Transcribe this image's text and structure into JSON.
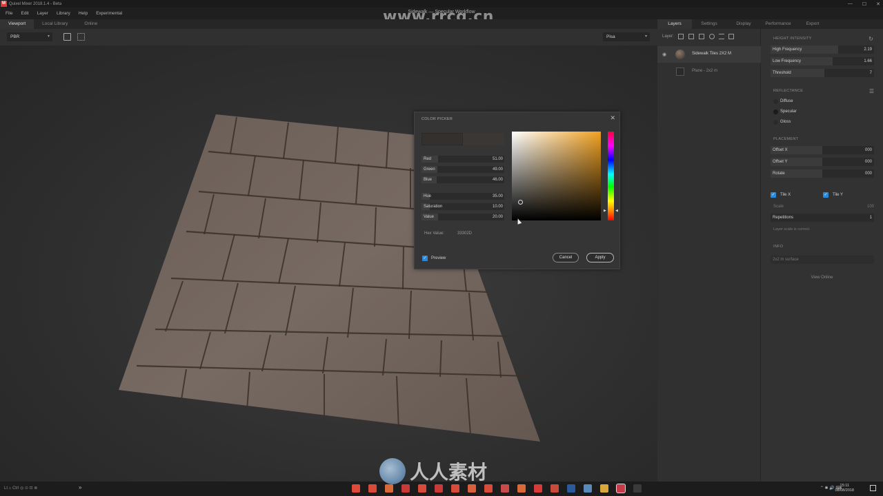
{
  "app": {
    "logo_letter": "M",
    "window_title": "Quixel Mixer 2018.1.4 - Beta",
    "document_title": "Sidewalk — Specular Workflow",
    "watermark_top": "www.rrcg.cn",
    "watermark_bottom": "人人素材"
  },
  "menu": [
    "File",
    "Edit",
    "Layer",
    "Library",
    "Help",
    "Experimental"
  ],
  "left_tabs": [
    "Viewport",
    "Local Library",
    "Online"
  ],
  "viewport": {
    "render_mode": "PBR",
    "environment": "Pisa"
  },
  "color_picker": {
    "title": "COLOR PICKER",
    "fields": [
      {
        "label": "Red",
        "value": "51.00",
        "fill": 0.2
      },
      {
        "label": "Green",
        "value": "49.00",
        "fill": 0.19
      },
      {
        "label": "Blue",
        "value": "46.00",
        "fill": 0.18
      },
      {
        "label": "Hue",
        "value": "35.00",
        "fill": 0.1
      },
      {
        "label": "Saturation",
        "value": "10.00",
        "fill": 0.1
      },
      {
        "label": "Value",
        "value": "20.00",
        "fill": 0.2
      }
    ],
    "hex_label": "Hex Value:",
    "hex_value": "33302D",
    "preview_label": "Preview",
    "cancel_label": "Cancel",
    "apply_label": "Apply",
    "current_color": "#33302e"
  },
  "right_tabs": [
    "Layers",
    "Settings",
    "Display",
    "Performance",
    "Export"
  ],
  "layers": {
    "toolbar_label": "Layer:",
    "items": [
      {
        "name": "Sidewalk Tiles 2X2 M"
      },
      {
        "name": "Plane - 2x2 m"
      }
    ]
  },
  "properties": {
    "height_intensity": {
      "title": "HEIGHT INTENSITY",
      "rows": [
        {
          "label": "High Frequency",
          "value": "2.19",
          "fill": 0.65
        },
        {
          "label": "Low Frequency",
          "value": "1.66",
          "fill": 0.6
        },
        {
          "label": "Threshold",
          "value": "7",
          "fill": 0.52
        }
      ]
    },
    "reflectance": {
      "title": "REFLECTANCE",
      "options": [
        "Diffuse",
        "Specular",
        "Gloss"
      ]
    },
    "placement": {
      "title": "PLACEMENT",
      "rows": [
        {
          "label": "Offset X",
          "value": "000",
          "fill": 0.5
        },
        {
          "label": "Offset Y",
          "value": "000",
          "fill": 0.5
        },
        {
          "label": "Rotate",
          "value": "000",
          "fill": 0.5
        }
      ],
      "tile_x": "Tile X",
      "tile_y": "Tile Y",
      "scale_label": "Scale",
      "scale_value": "100",
      "repetitions_label": "Repetitions",
      "repetitions_value": "1",
      "hint": "Layer scale is correct."
    },
    "info": {
      "title": "INFO",
      "text": "2x2 m surface",
      "link": "View Online"
    }
  },
  "status": {
    "left_text": "Lt  ⌂  Ctrl  ◎  ⊙  ⊡  ⊗",
    "time": "15:11",
    "date": "08/08/2018"
  },
  "taskbar_colors": [
    "#e04a3a",
    "#d84a3a",
    "#d86a3a",
    "#c83a3a",
    "#d84a3a",
    "#c83a3a",
    "#d84a3a",
    "#d8603a",
    "#d84a3a",
    "#c84a4a",
    "#d86a3a",
    "#d83a3a",
    "#c84a3a",
    "#2a5a9a",
    "#5a8ab8",
    "#d8a83a",
    "#c83a4a",
    "#3a3a3a"
  ]
}
